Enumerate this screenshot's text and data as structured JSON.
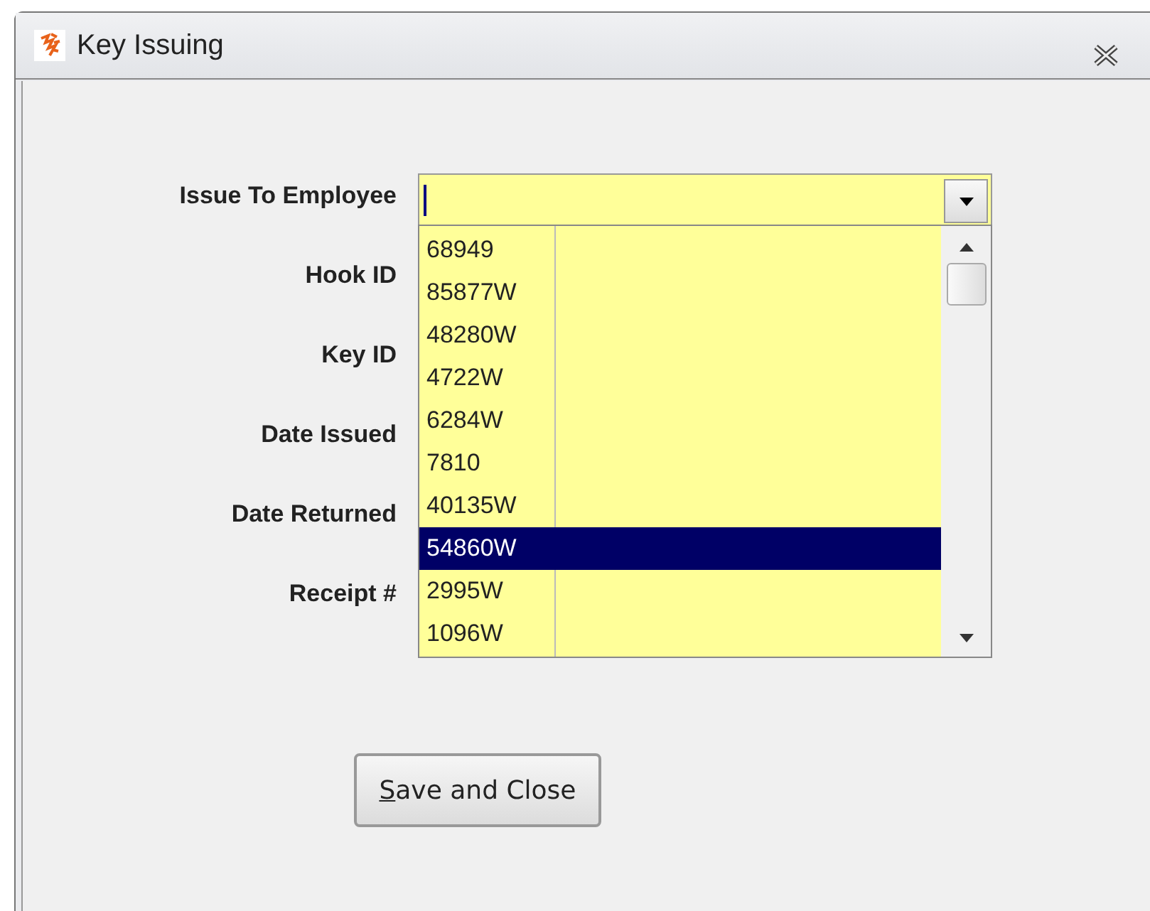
{
  "window": {
    "title": "Key Issuing"
  },
  "labels": [
    "Issue To Employee",
    "Hook ID",
    "Key ID",
    "Date Issued",
    "Date Returned",
    "Receipt #"
  ],
  "dropdown": {
    "items": [
      {
        "code": "68949",
        "selected": false
      },
      {
        "code": "85877W",
        "selected": false
      },
      {
        "code": "48280W",
        "selected": false
      },
      {
        "code": "4722W",
        "selected": false
      },
      {
        "code": "6284W",
        "selected": false
      },
      {
        "code": "7810",
        "selected": false
      },
      {
        "code": "40135W",
        "selected": false
      },
      {
        "code": "54860W",
        "selected": true
      },
      {
        "code": "2995W",
        "selected": false
      },
      {
        "code": "1096W",
        "selected": false
      }
    ]
  },
  "buttons": [
    "Save and Close"
  ]
}
